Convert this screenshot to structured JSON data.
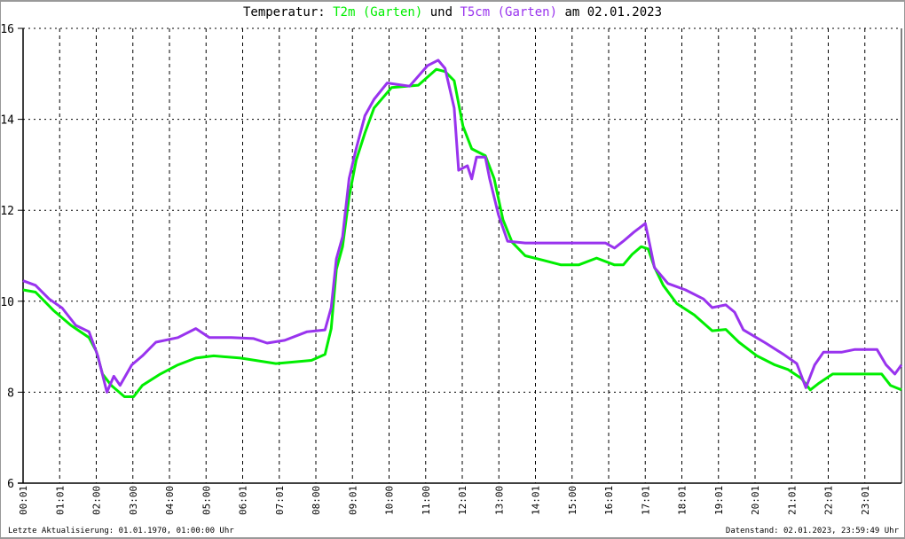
{
  "chart_data": {
    "type": "line",
    "title": {
      "prefix": "Temperatur: ",
      "series1": "T2m (Garten)",
      "join": " und ",
      "series2": "T5cm (Garten)",
      "suffix": " am 02.01.2023"
    },
    "xlabel": "",
    "ylabel": "",
    "xlim": [
      0,
      24
    ],
    "ylim": [
      6,
      16
    ],
    "yticks": [
      6,
      8,
      10,
      12,
      14,
      16
    ],
    "xtick_labels": [
      "00:01",
      "01:01",
      "02:00",
      "03:00",
      "04:00",
      "05:00",
      "06:01",
      "07:01",
      "08:00",
      "09:01",
      "10:00",
      "11:00",
      "12:01",
      "13:00",
      "14:01",
      "15:00",
      "16:01",
      "17:01",
      "18:01",
      "19:01",
      "20:01",
      "21:01",
      "22:01",
      "23:01"
    ],
    "grid": true,
    "series": [
      {
        "name": "T2m (Garten)",
        "color": "#00ee00",
        "points": [
          [
            0,
            10.25
          ],
          [
            0.34,
            10.2
          ],
          [
            0.83,
            9.8
          ],
          [
            1.31,
            9.47
          ],
          [
            1.8,
            9.2
          ],
          [
            2.0,
            8.9
          ],
          [
            2.17,
            8.4
          ],
          [
            2.41,
            8.15
          ],
          [
            2.77,
            7.9
          ],
          [
            3.02,
            7.9
          ],
          [
            3.26,
            8.15
          ],
          [
            3.75,
            8.4
          ],
          [
            4.23,
            8.6
          ],
          [
            4.72,
            8.75
          ],
          [
            5.21,
            8.8
          ],
          [
            5.94,
            8.75
          ],
          [
            6.91,
            8.63
          ],
          [
            7.88,
            8.7
          ],
          [
            8.25,
            8.83
          ],
          [
            8.42,
            9.4
          ],
          [
            8.56,
            10.7
          ],
          [
            8.73,
            11.2
          ],
          [
            8.91,
            12.3
          ],
          [
            9.1,
            13.1
          ],
          [
            9.34,
            13.7
          ],
          [
            9.59,
            14.25
          ],
          [
            10.07,
            14.7
          ],
          [
            10.8,
            14.75
          ],
          [
            11.29,
            15.1
          ],
          [
            11.53,
            15.05
          ],
          [
            11.78,
            14.85
          ],
          [
            12.02,
            13.85
          ],
          [
            12.26,
            13.35
          ],
          [
            12.63,
            13.2
          ],
          [
            12.87,
            12.7
          ],
          [
            13.11,
            11.8
          ],
          [
            13.36,
            11.3
          ],
          [
            13.72,
            11.0
          ],
          [
            14.21,
            10.9
          ],
          [
            14.7,
            10.8
          ],
          [
            15.18,
            10.8
          ],
          [
            15.67,
            10.95
          ],
          [
            16.16,
            10.8
          ],
          [
            16.4,
            10.8
          ],
          [
            16.64,
            11.03
          ],
          [
            16.89,
            11.2
          ],
          [
            17.08,
            11.15
          ],
          [
            17.25,
            10.75
          ],
          [
            17.49,
            10.35
          ],
          [
            17.86,
            9.95
          ],
          [
            18.34,
            9.7
          ],
          [
            18.83,
            9.35
          ],
          [
            19.2,
            9.38
          ],
          [
            19.56,
            9.1
          ],
          [
            20.05,
            8.8
          ],
          [
            20.54,
            8.6
          ],
          [
            20.9,
            8.5
          ],
          [
            21.27,
            8.3
          ],
          [
            21.51,
            8.05
          ],
          [
            21.75,
            8.2
          ],
          [
            22.12,
            8.4
          ],
          [
            22.73,
            8.4
          ],
          [
            23.46,
            8.4
          ],
          [
            23.7,
            8.15
          ],
          [
            24.0,
            8.05
          ]
        ]
      },
      {
        "name": "T5cm (Garten)",
        "color": "#9933ee",
        "points": [
          [
            0,
            10.45
          ],
          [
            0.34,
            10.35
          ],
          [
            0.71,
            10.05
          ],
          [
            1.07,
            9.85
          ],
          [
            1.44,
            9.47
          ],
          [
            1.8,
            9.33
          ],
          [
            2.04,
            8.8
          ],
          [
            2.29,
            8.0
          ],
          [
            2.48,
            8.35
          ],
          [
            2.65,
            8.15
          ],
          [
            2.97,
            8.6
          ],
          [
            3.26,
            8.8
          ],
          [
            3.63,
            9.1
          ],
          [
            4.23,
            9.2
          ],
          [
            4.72,
            9.4
          ],
          [
            5.09,
            9.2
          ],
          [
            5.69,
            9.2
          ],
          [
            6.3,
            9.18
          ],
          [
            6.67,
            9.08
          ],
          [
            7.15,
            9.14
          ],
          [
            7.76,
            9.33
          ],
          [
            8.25,
            9.37
          ],
          [
            8.42,
            9.86
          ],
          [
            8.56,
            10.93
          ],
          [
            8.73,
            11.42
          ],
          [
            8.91,
            12.7
          ],
          [
            9.1,
            13.35
          ],
          [
            9.34,
            14.08
          ],
          [
            9.59,
            14.44
          ],
          [
            9.95,
            14.8
          ],
          [
            10.56,
            14.73
          ],
          [
            11.05,
            15.18
          ],
          [
            11.34,
            15.3
          ],
          [
            11.53,
            15.12
          ],
          [
            11.78,
            14.25
          ],
          [
            11.9,
            12.88
          ],
          [
            12.14,
            12.98
          ],
          [
            12.26,
            12.69
          ],
          [
            12.39,
            13.17
          ],
          [
            12.63,
            13.17
          ],
          [
            12.75,
            12.69
          ],
          [
            12.99,
            11.9
          ],
          [
            13.24,
            11.32
          ],
          [
            13.72,
            11.28
          ],
          [
            14.45,
            11.28
          ],
          [
            15.43,
            11.28
          ],
          [
            15.91,
            11.28
          ],
          [
            16.16,
            11.17
          ],
          [
            16.4,
            11.32
          ],
          [
            16.69,
            11.52
          ],
          [
            17.0,
            11.71
          ],
          [
            17.13,
            11.22
          ],
          [
            17.25,
            10.74
          ],
          [
            17.62,
            10.39
          ],
          [
            18.1,
            10.25
          ],
          [
            18.59,
            10.05
          ],
          [
            18.83,
            9.86
          ],
          [
            19.2,
            9.92
          ],
          [
            19.44,
            9.76
          ],
          [
            19.68,
            9.37
          ],
          [
            20.29,
            9.08
          ],
          [
            20.78,
            8.83
          ],
          [
            21.14,
            8.63
          ],
          [
            21.39,
            8.1
          ],
          [
            21.63,
            8.6
          ],
          [
            21.87,
            8.88
          ],
          [
            22.36,
            8.88
          ],
          [
            22.73,
            8.94
          ],
          [
            23.33,
            8.94
          ],
          [
            23.58,
            8.6
          ],
          [
            23.82,
            8.4
          ],
          [
            24.0,
            8.6
          ]
        ]
      }
    ]
  },
  "footer": {
    "left": "Letzte Aktualisierung: 01.01.1970, 01:00:00 Uhr",
    "right": "Datenstand: 02.01.2023, 23:59:49 Uhr"
  }
}
